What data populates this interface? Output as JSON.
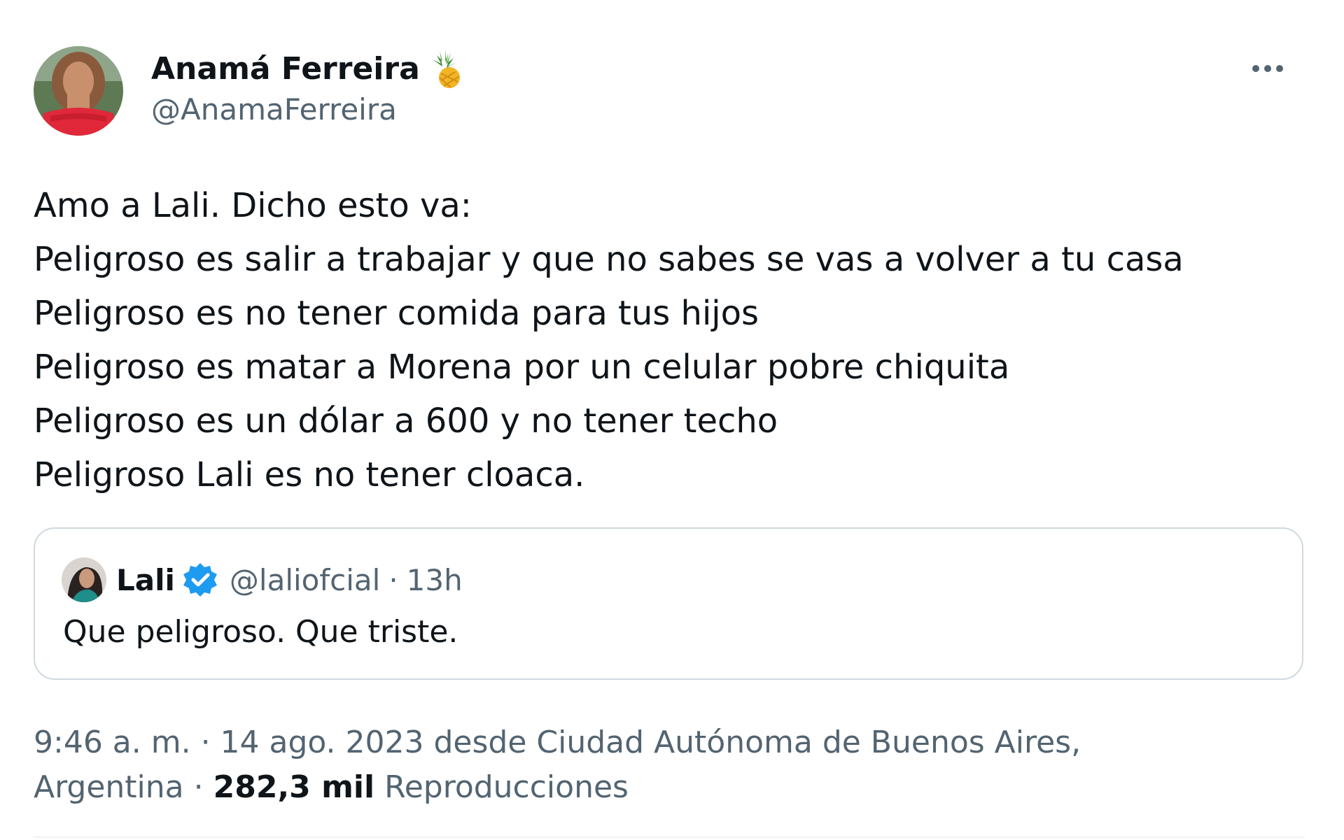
{
  "author": {
    "display_name": "Anamá Ferreira",
    "handle": "@AnamaFerreira",
    "name_emoji_icon": "pineapple-icon",
    "avatar_icon": "avatar-photo"
  },
  "tweet": {
    "lines": [
      "Amo a Lali. Dicho esto va:",
      "Peligroso es salir a trabajar y que no sabes se vas a volver a tu casa",
      "Peligroso es no tener comida para tus hijos",
      "Peligroso es matar a Morena por un celular pobre chiquita",
      "Peligroso es un dólar a 600 y no tener techo",
      "Peligroso Lali es no tener cloaca."
    ]
  },
  "quoted": {
    "display_name": "Lali",
    "handle": "@laliofcial",
    "dot": "·",
    "time": "13h",
    "text": "Que peligroso. Que triste.",
    "verified_icon": "verified-badge-icon",
    "verified_color": "#1d9bf0"
  },
  "meta": {
    "line1": "9:46 a. m. · 14 ago. 2023 desde Ciudad Autónoma de Buenos Aires,",
    "line2_prefix": "Argentina · ",
    "views_count": "282,3 mil",
    "views_label": " Reproducciones"
  },
  "colors": {
    "text_primary": "#0f1419",
    "text_secondary": "#536471",
    "border": "#cfd9de",
    "divider": "#eff3f4"
  }
}
